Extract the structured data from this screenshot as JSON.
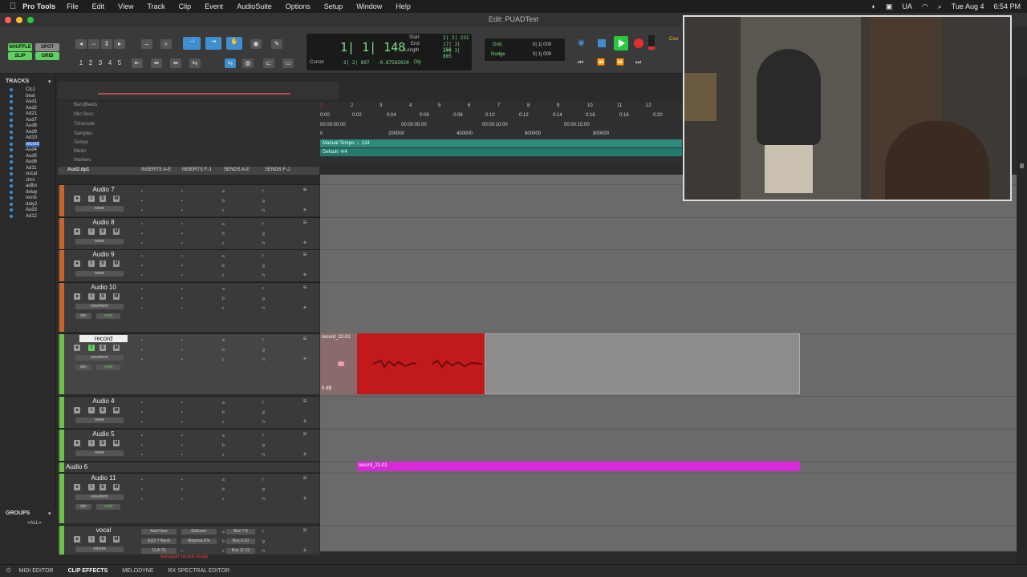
{
  "menubar": {
    "app": "Pro Tools",
    "items": [
      "File",
      "Edit",
      "View",
      "Track",
      "Clip",
      "Event",
      "AudioSuite",
      "Options",
      "Setup",
      "Window",
      "Help"
    ],
    "right": [
      "UA",
      "Tue Aug 4",
      "6:54 PM"
    ]
  },
  "window": {
    "title": "Edit: PUADTest"
  },
  "toolbar": {
    "modes": [
      "SHUFFLE",
      "SPOT",
      "SLIP",
      "GRID"
    ],
    "zoom_presets": [
      "1",
      "2",
      "3",
      "4",
      "5"
    ],
    "counter_main": "1| 1| 148",
    "start_label": "Start",
    "end_label": "End",
    "length_label": "Length",
    "start_val": "2| 2| 231",
    "end_val": "17| 2| 156",
    "length_val": "14| 3| 885",
    "cursor_label": "Cursor",
    "cursor_val": "2| 2| 897",
    "cursor_extra": "-0.87585020",
    "dly_label": "Dly",
    "grid_label": "Grid",
    "nudge_label": "Nudge",
    "grid_val": "0| 1| 000",
    "nudge_val": "0| 1| 000",
    "count_label": "Cou"
  },
  "tracks_panel": {
    "title": "TRACKS",
    "items": [
      "Clc1",
      "beat",
      "Aud1",
      "Aud2",
      "Ad21",
      "Aud7",
      "Aud8",
      "Aud9",
      "Ad10",
      "record",
      "Aud4",
      "Aud5",
      "Aud6",
      "Ad11",
      "vocal",
      "chrs",
      "adlbs",
      "delay",
      "revrb",
      "daly2",
      "Aud3",
      "Ad12"
    ],
    "groups_title": "GROUPS",
    "groups_all": "<ALL>"
  },
  "rulers": {
    "labels": [
      "Bars|Beats",
      "Min:Secs",
      "Timecode",
      "Samples",
      "Tempo",
      "Meter",
      "Markers"
    ],
    "bars": [
      "1",
      "2",
      "3",
      "4",
      "5",
      "6",
      "7",
      "8",
      "9",
      "10",
      "11",
      "12"
    ],
    "minsecs": [
      "0:00",
      "0:02",
      "0:04",
      "0:06",
      "0:08",
      "0:10",
      "0:12",
      "0:14",
      "0:16",
      "0:18",
      "0:20"
    ],
    "timecode": [
      "00:00:00:00",
      "00:00:05:00",
      "00:00:10:00",
      "00:00:15:00"
    ],
    "samples": [
      "0",
      "200000",
      "400000",
      "600000",
      "800000"
    ],
    "tempo_text": "Manual Tempo: ♩134",
    "meter_text": "Default: 4/4"
  },
  "mix_header": {
    "first_track": "Aud2.dp1",
    "columns": [
      "INSERTS A-E",
      "INSERTS F-J",
      "SENDS A-E",
      "SENDS F-J"
    ]
  },
  "tracks": [
    {
      "name": "Audio 7",
      "mode": "wave",
      "color": "#c8652e"
    },
    {
      "name": "Audio 8",
      "mode": "wave",
      "color": "#c8652e"
    },
    {
      "name": "Audio 9",
      "mode": "wave",
      "color": "#c8652e"
    },
    {
      "name": "Audio 10",
      "mode": "waveform",
      "mode2": "dyn",
      "mode3": "read",
      "color": "#c8652e"
    },
    {
      "name": "record",
      "mode": "waveform",
      "mode2": "dyn",
      "mode3": "read",
      "color": "#6bc24a"
    },
    {
      "name": "Audio 4",
      "mode": "wave",
      "color": "#6bc24a"
    },
    {
      "name": "Audio 5",
      "mode": "wave",
      "color": "#6bc24a"
    },
    {
      "name": "Audio 6",
      "color": "#6bc24a"
    },
    {
      "name": "Audio 11",
      "mode": "waveform",
      "mode2": "dyn",
      "mode3": "read",
      "color": "#6bc24a"
    },
    {
      "name": "vocal",
      "mode": "volume",
      "color": "#6bc24a"
    }
  ],
  "vocal_inserts": [
    "AutoTune",
    "EQ3 7-Band",
    "CLA-76"
  ],
  "vocal_inserts2": [
    "DeEsser",
    "MagmaLIITe"
  ],
  "vocal_sends": [
    "Bus 7-8",
    "Bus 9-10",
    "Bus 11-12"
  ],
  "clips": {
    "record": "record_22-01",
    "record_gain": "0 dB",
    "audio6": "record_21-01"
  },
  "status_text": "transport record ready",
  "bottom_tabs": [
    "MIDI EDITOR",
    "CLIP EFFECTS",
    "MELODYNE",
    "RX SPECTRAL EDITOR"
  ],
  "colors": {
    "orange": "#c8652e",
    "green": "#6bc24a",
    "record_clip": "#c21a1a",
    "audio6_clip": "#d62ad6",
    "tempo": "#2e8b7c"
  }
}
